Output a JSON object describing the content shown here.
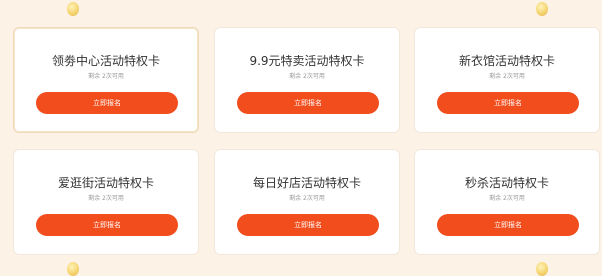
{
  "cards": [
    {
      "title": "领劵中心活动特权卡",
      "remaining": "剩余 2次可用",
      "button_label": "立即报名"
    },
    {
      "title": "9.9元特卖活动特权卡",
      "remaining": "剩余 2次可用",
      "button_label": "立即报名"
    },
    {
      "title": "新衣馆活动特权卡",
      "remaining": "剩余 2次可用",
      "button_label": "立即报名"
    },
    {
      "title": "爱逛街活动特权卡",
      "remaining": "剩余 2次可用",
      "button_label": "立即报名"
    },
    {
      "title": "每日好店活动特权卡",
      "remaining": "剩余 2次可用",
      "button_label": "立即报名"
    },
    {
      "title": "秒杀活动特权卡",
      "remaining": "剩余 2次可用",
      "button_label": "立即报名"
    }
  ],
  "colors": {
    "page_background": "#fdf2e6",
    "card_background": "#ffffff",
    "button": "#f24d1d",
    "button_text": "#ffffff",
    "title_text": "#333333",
    "sub_text": "#999999"
  }
}
